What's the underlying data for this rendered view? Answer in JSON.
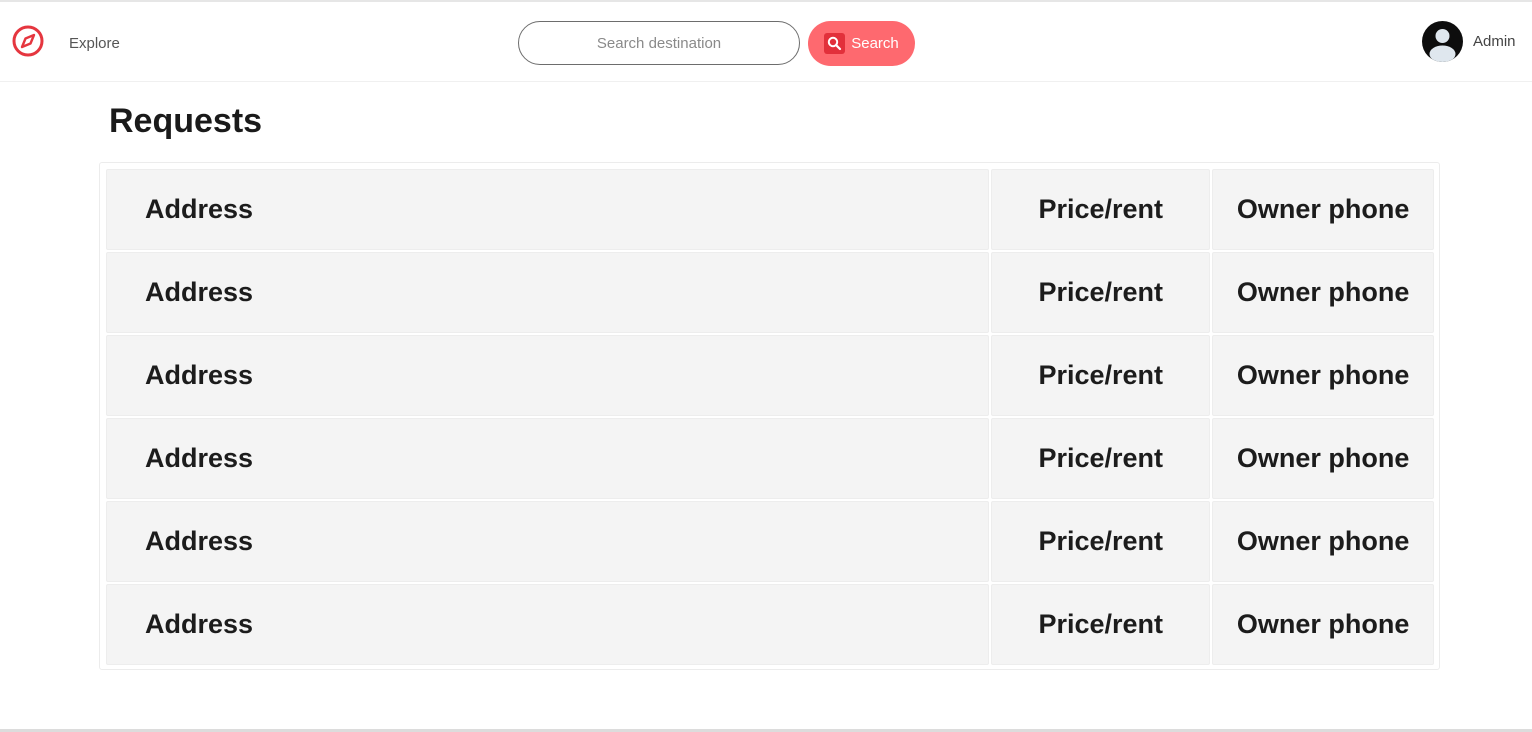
{
  "navbar": {
    "explore_label": "Explore",
    "search": {
      "placeholder": "Search destination",
      "value": "",
      "button_label": "Search"
    },
    "user_name": "Admin"
  },
  "main": {
    "title": "Requests",
    "table": {
      "rows": [
        {
          "address": "Address",
          "price": "Price/rent",
          "phone": "Owner phone"
        },
        {
          "address": "Address",
          "price": "Price/rent",
          "phone": "Owner phone"
        },
        {
          "address": "Address",
          "price": "Price/rent",
          "phone": "Owner phone"
        },
        {
          "address": "Address",
          "price": "Price/rent",
          "phone": "Owner phone"
        },
        {
          "address": "Address",
          "price": "Price/rent",
          "phone": "Owner phone"
        },
        {
          "address": "Address",
          "price": "Price/rent",
          "phone": "Owner phone"
        }
      ]
    }
  },
  "icons": {
    "logo": "compass-icon",
    "search": "search-icon",
    "avatar": "user-avatar-icon"
  },
  "colors": {
    "accent": "#fe696f",
    "accent_dark": "#e2303b",
    "cell_background": "#f4f4f4",
    "text": "#1a1a1a"
  }
}
